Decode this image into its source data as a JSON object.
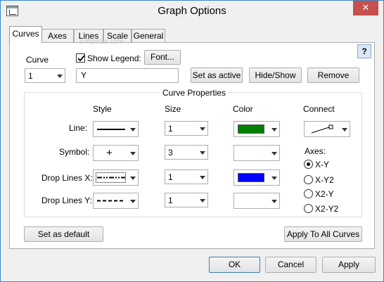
{
  "window": {
    "title": "Graph Options",
    "close_glyph": "✕"
  },
  "tabs": [
    {
      "label": "Curves",
      "active": true
    },
    {
      "label": "Axes"
    },
    {
      "label": "Lines"
    },
    {
      "label": "Scale"
    },
    {
      "label": "General"
    }
  ],
  "help": {
    "label": "?"
  },
  "watermark": "softpedia.com",
  "curve": {
    "label": "Curve",
    "selected": "1",
    "show_legend_label": "Show Legend:",
    "show_legend_checked": true,
    "font_button": "Font...",
    "name_value": "Y",
    "buttons": {
      "set_active": "Set as active",
      "hide_show": "Hide/Show",
      "remove": "Remove"
    }
  },
  "curve_properties": {
    "title": "Curve Properties",
    "headers": {
      "style": "Style",
      "size": "Size",
      "color": "Color",
      "connect": "Connect"
    },
    "rows": [
      {
        "label": "Line:",
        "style": "solid",
        "size": "1",
        "color": "#007f00"
      },
      {
        "label": "Symbol:",
        "style": "plus",
        "symbol": "+",
        "size": "3",
        "color": ""
      },
      {
        "label": "Drop Lines X:",
        "style": "dashdotdot",
        "size": "1",
        "color": "#0000ff"
      },
      {
        "label": "Drop Lines Y:",
        "style": "dashed",
        "size": "1",
        "color": ""
      }
    ],
    "axes": {
      "label": "Axes:",
      "options": [
        {
          "label": "X-Y",
          "selected": true
        },
        {
          "label": "X-Y2",
          "selected": false
        },
        {
          "label": "X2-Y",
          "selected": false
        },
        {
          "label": "X2-Y2",
          "selected": false
        }
      ]
    }
  },
  "actions": {
    "set_default": "Set as default",
    "apply_all": "Apply To All Curves"
  },
  "footer": {
    "ok": "OK",
    "cancel": "Cancel",
    "apply": "Apply"
  }
}
